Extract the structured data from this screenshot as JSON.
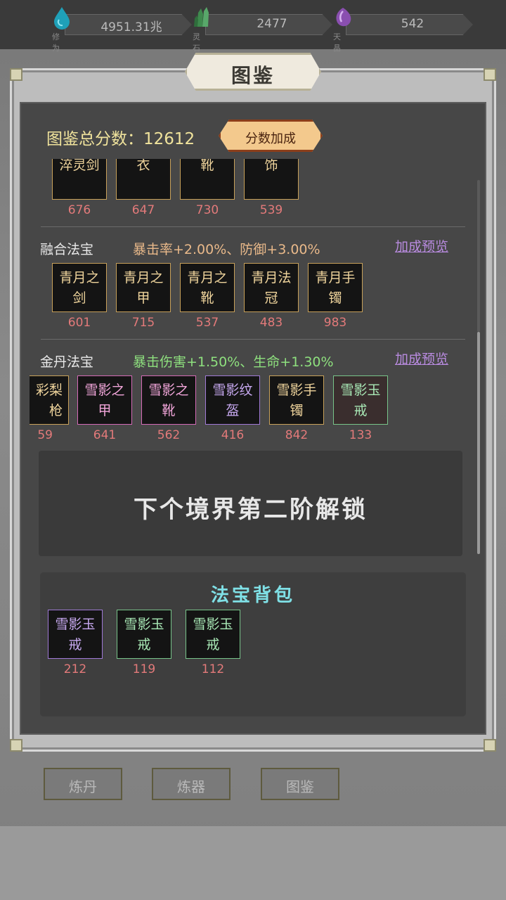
{
  "resources": [
    {
      "value": "4951.31兆",
      "caption": "修为",
      "icon": "water-drop-icon",
      "color": "#1fa0b8"
    },
    {
      "value": "2477",
      "caption": "灵石",
      "icon": "crystal-icon",
      "color": "#3f8a4e"
    },
    {
      "value": "542",
      "caption": "天晶",
      "icon": "purple-crystal-icon",
      "color": "#8a4fb0"
    }
  ],
  "panel": {
    "title": "图鉴"
  },
  "score": {
    "label": "图鉴总分数：12612",
    "button": "分数加成"
  },
  "sections": [
    {
      "items": [
        {
          "name": "淬灵剑",
          "value": "676",
          "color": "gold"
        },
        {
          "name": "淬灵法\n衣",
          "value": "647",
          "color": "gold"
        },
        {
          "name": "淬灵之\n靴",
          "value": "730",
          "color": "gold"
        },
        {
          "name": "淬灵头\n饰",
          "value": "539",
          "color": "gold"
        }
      ]
    },
    {
      "name": "融合法宝",
      "bonus": "暴击率+2.00%、防御+3.00%",
      "preview": "加成预览",
      "items": [
        {
          "name": "青月之\n剑",
          "value": "601",
          "color": "gold"
        },
        {
          "name": "青月之\n甲",
          "value": "715",
          "color": "gold"
        },
        {
          "name": "青月之\n靴",
          "value": "537",
          "color": "gold"
        },
        {
          "name": "青月法\n冠",
          "value": "483",
          "color": "gold"
        },
        {
          "name": "青月手\n镯",
          "value": "983",
          "color": "gold"
        }
      ]
    },
    {
      "name": "金丹法宝",
      "bonus": "暴击伤害+1.50%、生命+1.30%",
      "preview": "加成预览",
      "items": [
        {
          "name": "彩梨\n枪",
          "value": "59",
          "color": "gold"
        },
        {
          "name": "雪影之\n甲",
          "value": "641",
          "color": "pink"
        },
        {
          "name": "雪影之\n靴",
          "value": "562",
          "color": "pink"
        },
        {
          "name": "雪影纹\n盔",
          "value": "416",
          "color": "purple"
        },
        {
          "name": "雪影手\n镯",
          "value": "842",
          "color": "gold"
        },
        {
          "name": "雪影玉\n戒",
          "value": "133",
          "color": "green"
        }
      ]
    }
  ],
  "lock_text": "下个境界第二阶解锁",
  "bag": {
    "title": "法宝背包",
    "items": [
      {
        "name": "雪影玉\n戒",
        "value": "212",
        "color": "purple"
      },
      {
        "name": "雪影玉\n戒",
        "value": "119",
        "color": "green"
      },
      {
        "name": "雪影玉\n戒",
        "value": "112",
        "color": "green"
      }
    ]
  },
  "bottom_tabs": [
    "炼丹",
    "炼器",
    "图鉴"
  ],
  "colors": {
    "gold_border": "#c8a15a",
    "gold_text": "#efd49c",
    "pink_border": "#d46ab6",
    "pink_text": "#f2a6da",
    "purple_border": "#a079d6",
    "purple_text": "#c7a9f0",
    "green_border": "#78c48a",
    "green_text": "#a9e9b6",
    "bonus_green": "#8ee07e",
    "bonus_orange": "#e9b98a",
    "number_red": "#e37a7a"
  }
}
